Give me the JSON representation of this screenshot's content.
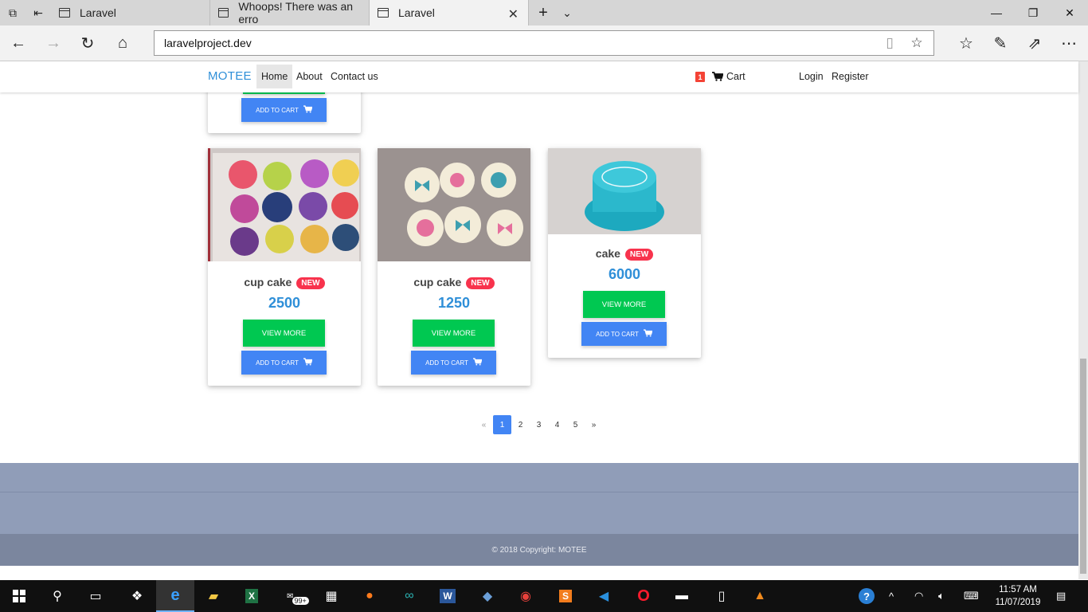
{
  "browser": {
    "tabs": [
      {
        "label": "Laravel",
        "active": false
      },
      {
        "label": "Whoops! There was an erro",
        "active": false
      },
      {
        "label": "Laravel",
        "active": true
      }
    ],
    "url": "laravelproject.dev"
  },
  "site_nav": {
    "brand": "MOTEE",
    "links": [
      "Home",
      "About",
      "Contact us"
    ],
    "cart_count": "1",
    "cart_label": "Cart",
    "login": "Login",
    "register": "Register"
  },
  "products": [
    {
      "name": "cup cake",
      "badge": "NEW",
      "price": "2500",
      "view_label": "VIEW MORE",
      "cart_label": "ADD TO CART",
      "image": "cupcakes-lettered"
    },
    {
      "name": "cup cake",
      "badge": "NEW",
      "price": "1250",
      "view_label": "VIEW MORE",
      "cart_label": "ADD TO CART",
      "image": "cupcakes-bows"
    },
    {
      "name": "cake",
      "badge": "NEW",
      "price": "6000",
      "view_label": "VIEW MORE",
      "cart_label": "ADD TO CART",
      "image": "blue-cake"
    }
  ],
  "partial_card": {
    "cart_label": "ADD TO CART"
  },
  "pagination": {
    "prev": "«",
    "pages": [
      "1",
      "2",
      "3",
      "4",
      "5"
    ],
    "active": "1",
    "next": "»"
  },
  "footer": {
    "copyright": "© 2018 Copyright: MOTEE"
  },
  "taskbar": {
    "badge": "99+",
    "time": "11:57 AM",
    "date": "11/07/2019"
  },
  "colors": {
    "brand": "#2f8fd8",
    "view_more": "#00c851",
    "add_to_cart": "#4285f4",
    "badge_new": "#f8334d",
    "footer": "#909db8"
  }
}
